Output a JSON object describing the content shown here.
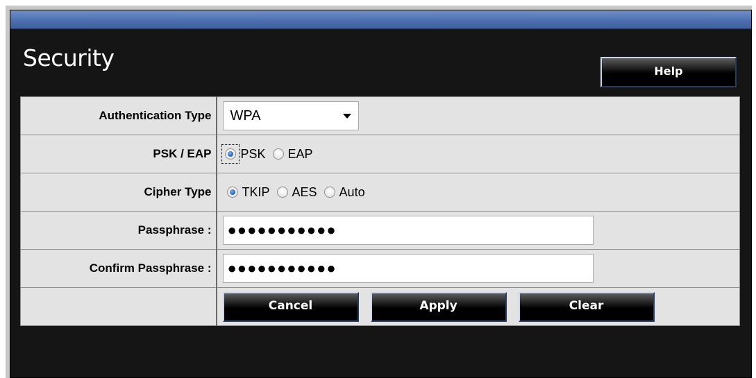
{
  "page": {
    "title": "Security",
    "help_label": "Help"
  },
  "form": {
    "auth_type": {
      "label": "Authentication Type",
      "selected": "WPA"
    },
    "psk_eap": {
      "label": "PSK / EAP",
      "options": [
        "PSK",
        "EAP"
      ],
      "selected": "PSK"
    },
    "cipher": {
      "label": "Cipher Type",
      "options": [
        "TKIP",
        "AES",
        "Auto"
      ],
      "selected": "TKIP"
    },
    "passphrase": {
      "label": "Passphrase :",
      "value": "●●●●●●●●●●●"
    },
    "confirm_passphrase": {
      "label": "Confirm Passphrase :",
      "value": "●●●●●●●●●●●"
    }
  },
  "buttons": {
    "cancel": "Cancel",
    "apply": "Apply",
    "clear": "Clear"
  },
  "colors": {
    "panel_bg": "#151515",
    "title_bar": "#4b6eae",
    "row_bg": "#e3e3e3",
    "radio_checked": "#2a68c2"
  }
}
